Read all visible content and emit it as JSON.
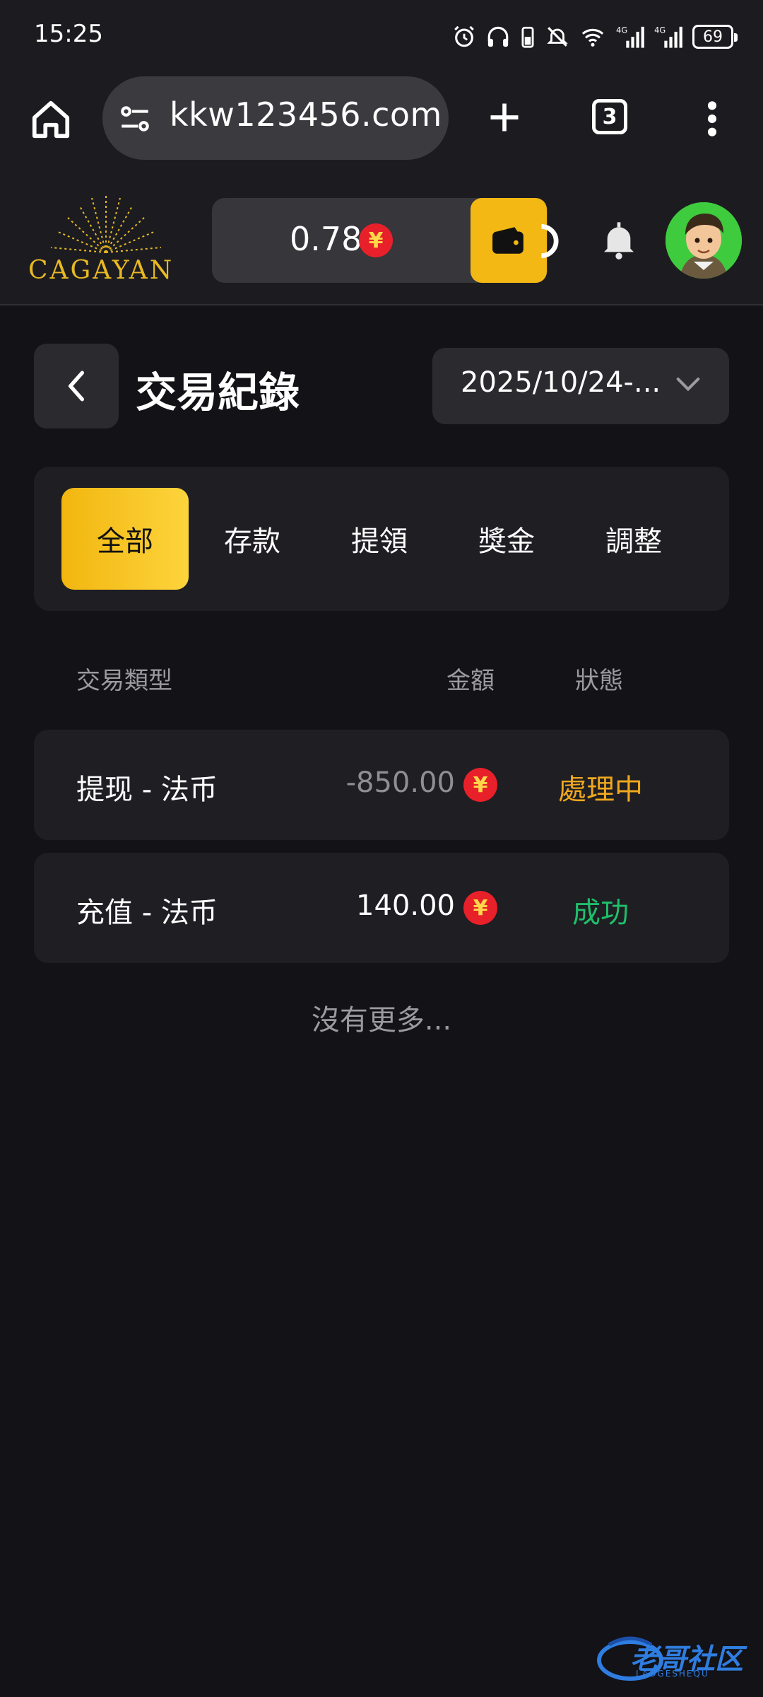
{
  "status_bar": {
    "time": "15:25",
    "battery": "69"
  },
  "browser": {
    "url": "kkw123456.com",
    "tab_count": "3"
  },
  "header": {
    "logo_text": "CAGAYAN",
    "balance": "0.78",
    "currency_symbol": "¥"
  },
  "page": {
    "title": "交易紀錄",
    "date_range": "2025/10/24-..."
  },
  "tabs": [
    {
      "label": "全部",
      "active": true
    },
    {
      "label": "存款",
      "active": false
    },
    {
      "label": "提領",
      "active": false
    },
    {
      "label": "獎金",
      "active": false
    },
    {
      "label": "調整",
      "active": false
    }
  ],
  "table": {
    "headers": {
      "type": "交易類型",
      "amount": "金額",
      "status": "狀態"
    },
    "rows": [
      {
        "type": "提现 - 法币",
        "amount": "-850.00",
        "status": "處理中",
        "status_color": "#f0a81e",
        "amount_color": "#8e8e94"
      },
      {
        "type": "充值 - 法币",
        "amount": "140.00",
        "status": "成功",
        "status_color": "#1fbf6a",
        "amount_color": "#ffffff"
      }
    ],
    "end_text": "沒有更多..."
  },
  "watermark": {
    "text": "老哥社区",
    "sub": "LAOGESHEQU"
  }
}
